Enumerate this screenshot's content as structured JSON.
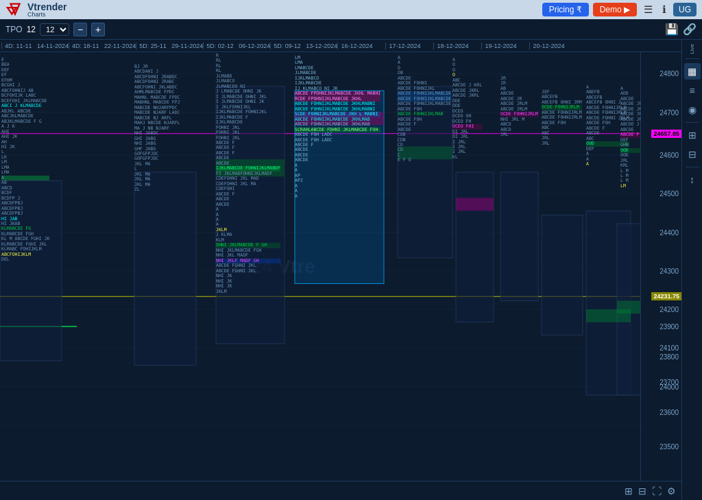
{
  "nav": {
    "logo_text": "Vtrender",
    "logo_sub": "Charts",
    "pricing_label": "Pricing ₹",
    "demo_label": "Demo ▶",
    "nav_icons": [
      "☰",
      "ℹ",
      "UG"
    ]
  },
  "toolbar": {
    "tpo_label": "TPO",
    "tpo_value": "12",
    "minus_label": "−",
    "plus_label": "+",
    "save_icon": "💾",
    "share_icon": "🔗"
  },
  "dates": [
    "4D: 11-11  14-11-2024",
    "4D: 18-11  22-11-2024",
    "5D: 25-11  29-11-2024",
    "5D: 02-12  06-12-2024",
    "5D: 09-12  13-12-2024",
    "16-12-2024",
    "17-12-2024",
    "18-12-2024",
    "19-12-2024",
    "20-12-2024"
  ],
  "prices": [
    {
      "value": "24800",
      "pct": 5
    },
    {
      "value": "24700",
      "pct": 14
    },
    {
      "value": "24657.85",
      "pct": 19,
      "highlight": "pink"
    },
    {
      "value": "24600",
      "pct": 24
    },
    {
      "value": "24500",
      "pct": 33
    },
    {
      "value": "24400",
      "pct": 42
    },
    {
      "value": "24300",
      "pct": 51
    },
    {
      "value": "24231.75",
      "pct": 57,
      "highlight": "yellow"
    },
    {
      "value": "24200",
      "pct": 60
    },
    {
      "value": "24100",
      "pct": 69
    },
    {
      "value": "24000",
      "pct": 78
    },
    {
      "value": "23900",
      "pct": 64
    },
    {
      "value": "23800",
      "pct": 70
    },
    {
      "value": "23700",
      "pct": 77
    },
    {
      "value": "23600",
      "pct": 84
    },
    {
      "value": "23500",
      "pct": 92
    }
  ],
  "watermark": "2024 Vtre",
  "bottom_icons": [
    "⊞",
    "⊟",
    "⛶",
    "⚙"
  ],
  "sidebar_items": [
    {
      "label": "Live",
      "active": false
    },
    {
      "icon": "▦",
      "active": true
    },
    {
      "icon": "≡",
      "active": false
    },
    {
      "icon": "◉",
      "active": false
    },
    {
      "icon": "⊞",
      "active": false
    },
    {
      "icon": "⊟",
      "active": false
    },
    {
      "icon": "↕",
      "active": false
    }
  ]
}
